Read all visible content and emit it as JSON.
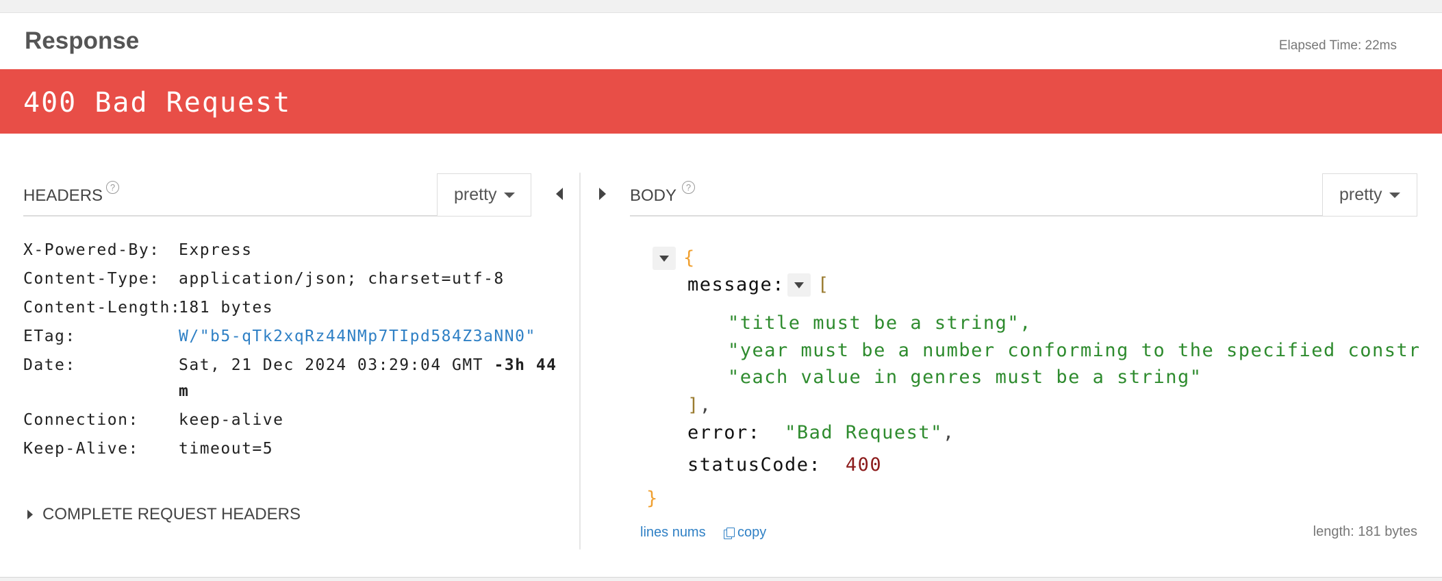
{
  "response": {
    "title": "Response",
    "elapsed": "Elapsed Time: 22ms",
    "status": "400 Bad Request"
  },
  "headers_panel": {
    "title": "HEADERS",
    "help": "?",
    "format": "pretty",
    "rows": [
      {
        "name": "X-Powered-By:",
        "value": "Express"
      },
      {
        "name": "Content-Type:",
        "value": "application/json; charset=utf-8"
      },
      {
        "name": "Content-Length:",
        "value": "181 bytes"
      },
      {
        "name": "ETag:",
        "value": "W/\"b5-qTk2xqRz44NMp7TIpd584Z3aNN0\""
      },
      {
        "name": "Date:",
        "value": "Sat, 21 Dec 2024 03:29:04 GMT",
        "relative_line1": "-3h 44",
        "relative_line2": "m"
      },
      {
        "name": "Connection:",
        "value": "keep-alive"
      },
      {
        "name": "Keep-Alive:",
        "value": "timeout=5"
      }
    ],
    "complete_request_headers": "COMPLETE REQUEST HEADERS"
  },
  "body_panel": {
    "title": "BODY",
    "help": "?",
    "format": "pretty",
    "json": {
      "open_brace": "{",
      "close_brace": "}",
      "message_key": "message:",
      "open_bracket": "[",
      "close_bracket": "]",
      "comma": ",",
      "message_items": [
        "\"title must be a string\",",
        "\"year must be a number conforming to the specified constraints\",",
        "\"each value in genres must be a string\""
      ],
      "error_key": "error:",
      "error_value": "\"Bad Request\"",
      "status_key": "statusCode:",
      "status_value": "400"
    },
    "lines_nums": "lines nums",
    "copy": "copy",
    "length": "length: 181 bytes"
  },
  "colors": {
    "status_bar": "#e84e47",
    "link": "#2f80c5",
    "json_string": "#2e8b2e",
    "json_number": "#8b1a1a",
    "json_brace": "#f0a030"
  }
}
